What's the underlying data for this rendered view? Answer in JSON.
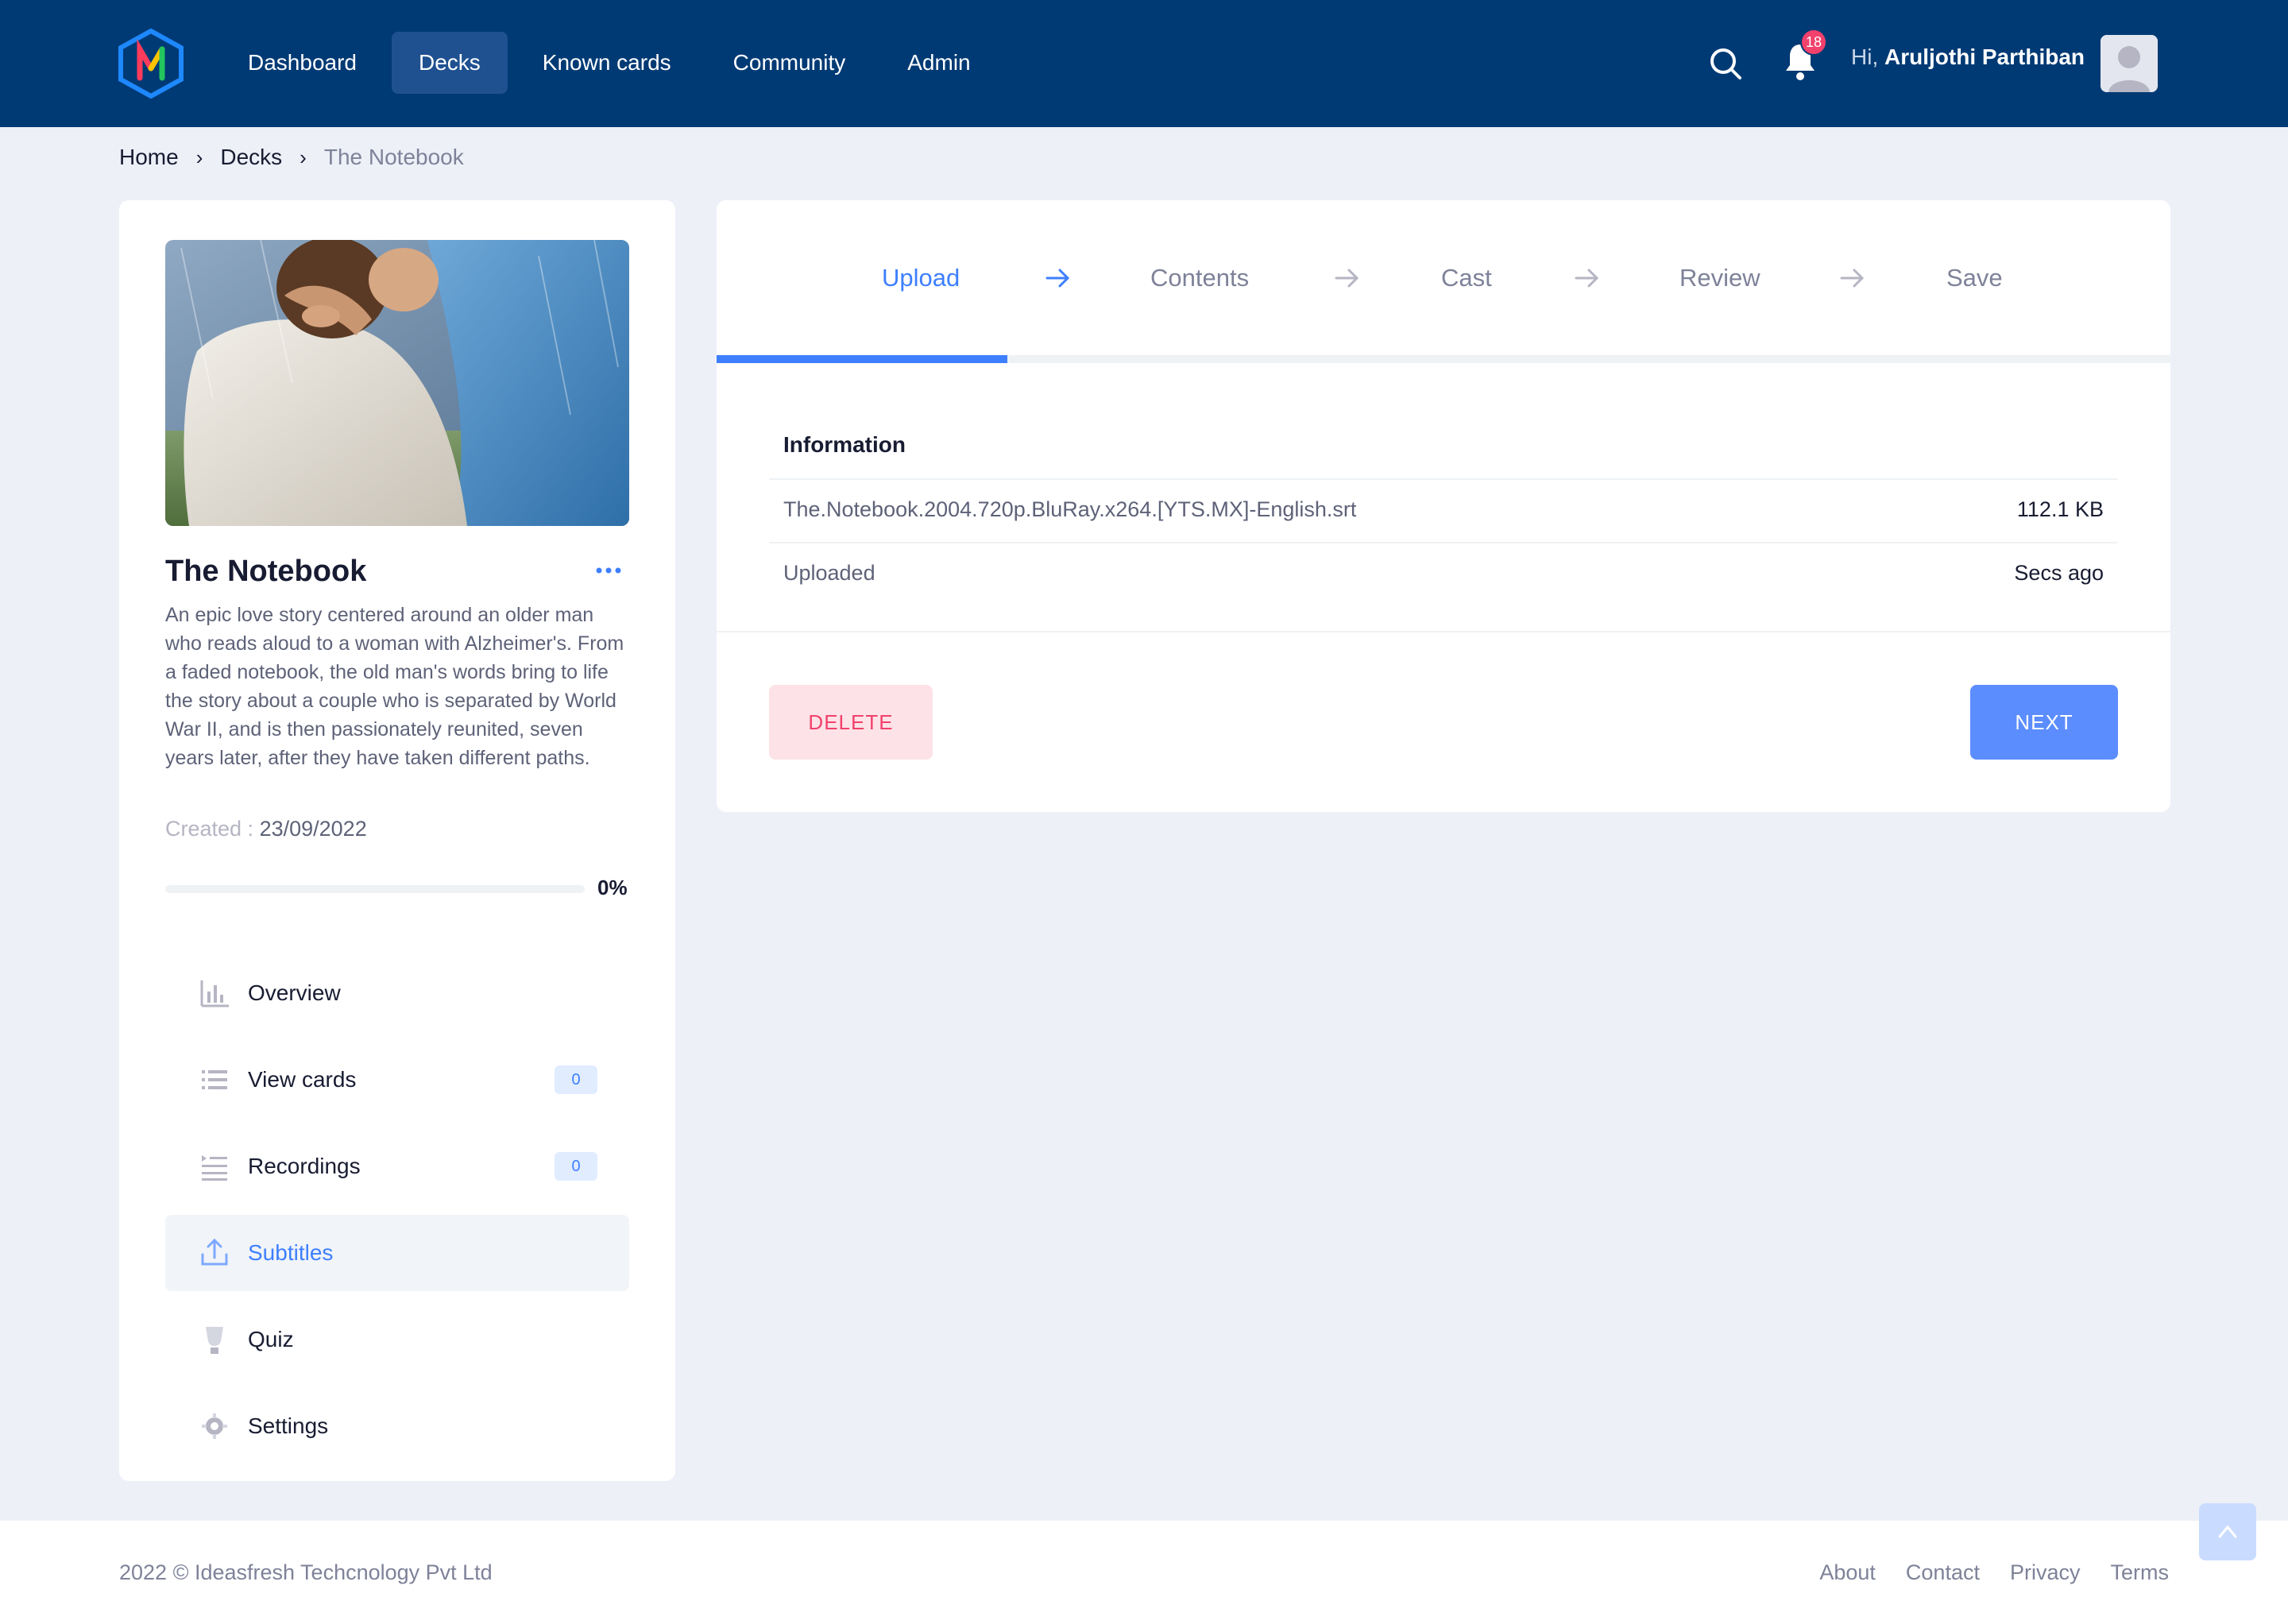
{
  "header": {
    "nav": [
      "Dashboard",
      "Decks",
      "Known cards",
      "Community",
      "Admin"
    ],
    "active_nav": "Decks",
    "notification_count": "18",
    "greeting_prefix": "Hi,",
    "user_name": "Aruljothi Parthiban",
    "icons": {
      "search": "search-icon",
      "bell": "bell-icon",
      "avatar": "avatar-icon"
    }
  },
  "breadcrumb": [
    "Home",
    "Decks",
    "The Notebook"
  ],
  "deck": {
    "title": "The Notebook",
    "description": "An epic love story centered around an older man who reads aloud to a woman with Alzheimer's. From a faded notebook, the old man's words bring to life the story about a couple who is separated by World War II, and is then passionately reunited, seven years later, after they have taken different paths.",
    "created_label": "Created :",
    "created_date": "23/09/2022",
    "progress": 0,
    "progress_label": "0%"
  },
  "menu": [
    {
      "label": "Overview",
      "icon": "chart-bar-icon",
      "badge": ""
    },
    {
      "label": "View cards",
      "icon": "list-icon",
      "badge": "0"
    },
    {
      "label": "Recordings",
      "icon": "recording-list-icon",
      "badge": "0"
    },
    {
      "label": "Subtitles",
      "icon": "upload-icon",
      "badge": "",
      "active": true
    },
    {
      "label": "Quiz",
      "icon": "trophy-icon",
      "badge": ""
    },
    {
      "label": "Settings",
      "icon": "gear-icon",
      "badge": ""
    }
  ],
  "wizard": {
    "steps": [
      "Upload",
      "Contents",
      "Cast",
      "Review",
      "Save"
    ],
    "active_step": 0,
    "progress": 0.2,
    "info_title": "Information",
    "file_name": "The.Notebook.2004.720p.BluRay.x264.[YTS.MX]-English.srt",
    "file_size": "112.1 KB",
    "uploaded_label": "Uploaded",
    "uploaded_value": "Secs ago",
    "delete_label": "DELETE",
    "next_label": "NEXT"
  },
  "footer": {
    "copyright": "2022 © Ideasfresh Techcnology Pvt Ltd",
    "links": [
      "About",
      "Contact",
      "Privacy",
      "Terms"
    ]
  },
  "colors": {
    "header_bg": "#003a74",
    "accent": "#3e7fff",
    "danger": "#f1416c"
  }
}
